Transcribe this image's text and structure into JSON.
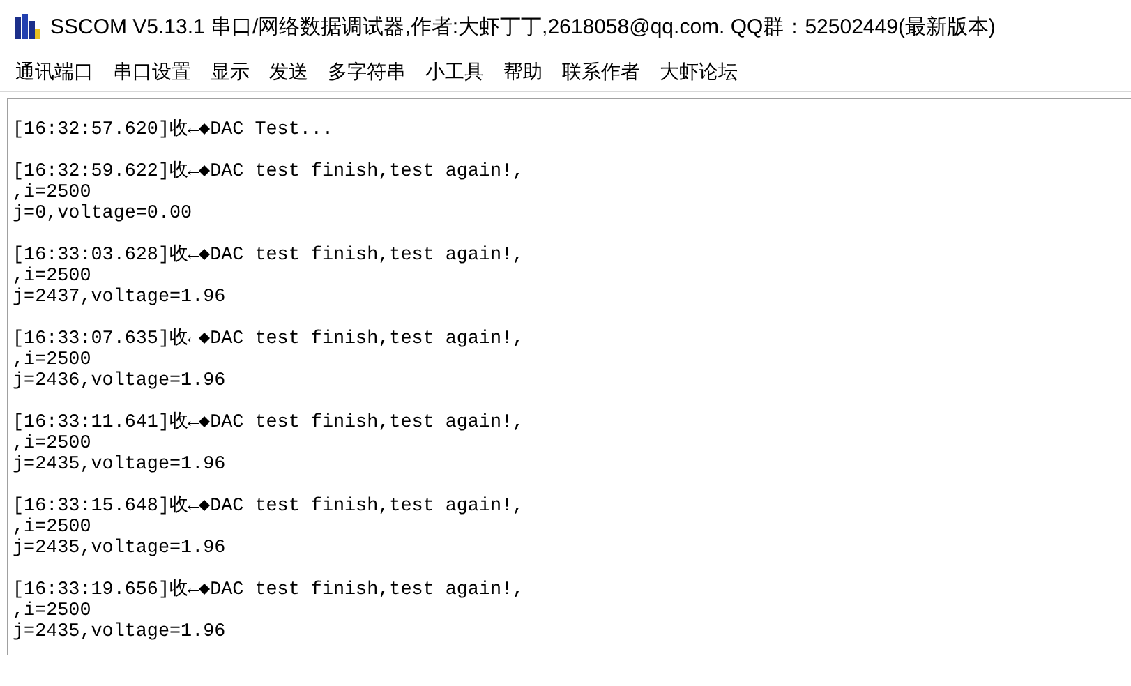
{
  "window": {
    "title": "SSCOM V5.13.1 串口/网络数据调试器,作者:大虾丁丁,2618058@qq.com. QQ群：52502449(最新版本)"
  },
  "menu": [
    "通讯端口",
    "串口设置",
    "显示",
    "发送",
    "多字符串",
    "小工具",
    "帮助",
    "联系作者",
    "大虾论坛"
  ],
  "log": [
    {
      "header": "[16:32:57.620]收←◆DAC Test..."
    },
    {
      "header": "[16:32:59.622]收←◆DAC test finish,test again!,",
      "lines": [
        ",i=2500",
        "j=0,voltage=0.00"
      ]
    },
    {
      "header": "[16:33:03.628]收←◆DAC test finish,test again!,",
      "lines": [
        ",i=2500",
        "j=2437,voltage=1.96"
      ]
    },
    {
      "header": "[16:33:07.635]收←◆DAC test finish,test again!,",
      "lines": [
        ",i=2500",
        "j=2436,voltage=1.96"
      ]
    },
    {
      "header": "[16:33:11.641]收←◆DAC test finish,test again!,",
      "lines": [
        ",i=2500",
        "j=2435,voltage=1.96"
      ]
    },
    {
      "header": "[16:33:15.648]收←◆DAC test finish,test again!,",
      "lines": [
        ",i=2500",
        "j=2435,voltage=1.96"
      ]
    },
    {
      "header": "[16:33:19.656]收←◆DAC test finish,test again!,",
      "lines": [
        ",i=2500",
        "j=2435,voltage=1.96"
      ]
    }
  ]
}
